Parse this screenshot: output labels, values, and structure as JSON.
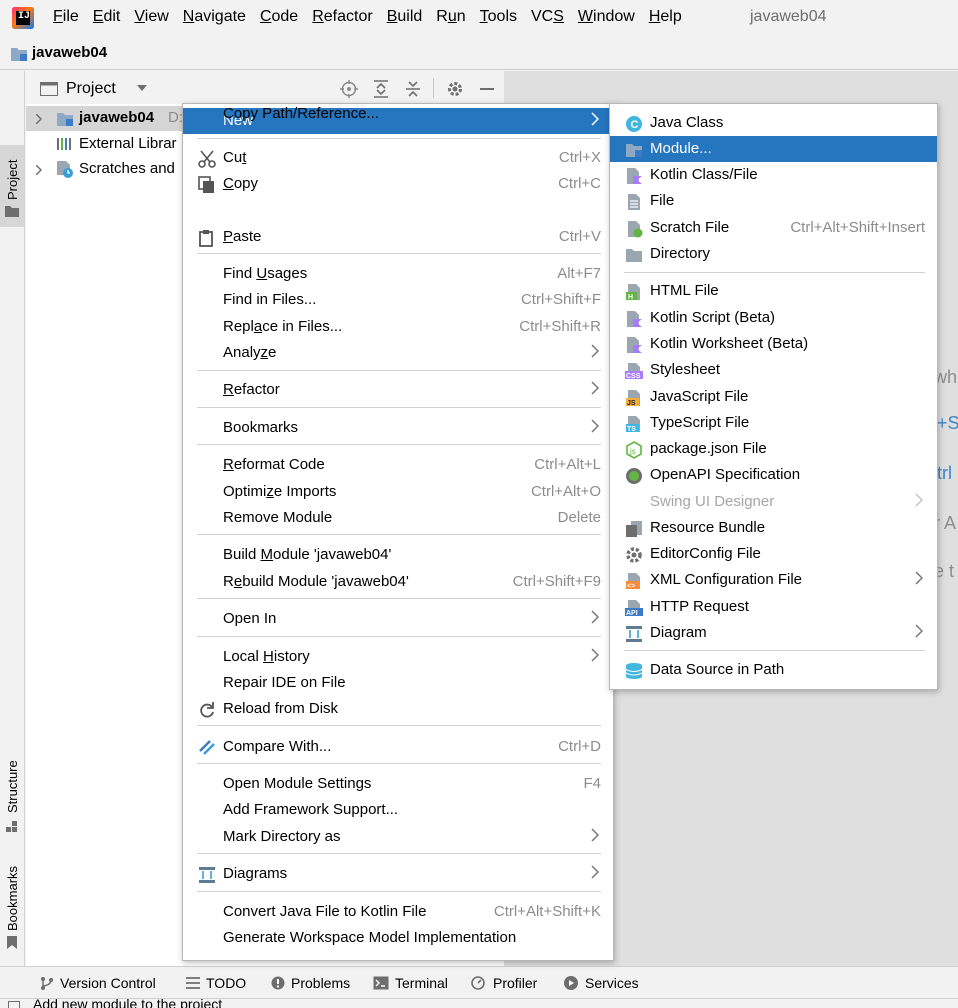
{
  "window": {
    "title": "javaweb04"
  },
  "menubar": [
    {
      "pre": "",
      "u": "F",
      "post": "ile"
    },
    {
      "pre": "",
      "u": "E",
      "post": "dit"
    },
    {
      "pre": "",
      "u": "V",
      "post": "iew"
    },
    {
      "pre": "",
      "u": "N",
      "post": "avigate"
    },
    {
      "pre": "",
      "u": "C",
      "post": "ode"
    },
    {
      "pre": "",
      "u": "R",
      "post": "efactor"
    },
    {
      "pre": "",
      "u": "B",
      "post": "uild"
    },
    {
      "pre": "R",
      "u": "u",
      "post": "n"
    },
    {
      "pre": "",
      "u": "T",
      "post": "ools"
    },
    {
      "pre": "VC",
      "u": "S",
      "post": ""
    },
    {
      "pre": "",
      "u": "W",
      "post": "indow"
    },
    {
      "pre": "",
      "u": "H",
      "post": "elp"
    }
  ],
  "breadcrumb": {
    "project": "javaweb04"
  },
  "left_strip": {
    "project": "Project",
    "structure": "Structure",
    "bookmarks": "Bookmarks"
  },
  "project_panel": {
    "title": "Project",
    "tree": [
      {
        "label": "javaweb04",
        "suffix": "D:"
      },
      {
        "label": "External Librar"
      },
      {
        "label": "Scratches and"
      }
    ]
  },
  "editor_hints": [
    "wh",
    "+S",
    "trl",
    "r A",
    "e t"
  ],
  "context_menu": [
    {
      "label_parts": [
        "New"
      ],
      "underline": [],
      "shortcut": "",
      "submenu": true,
      "highlight": true
    },
    {
      "sep": true
    },
    {
      "pre": "Cu",
      "u": "t",
      "post": "",
      "shortcut": "Ctrl+X",
      "icon": "scissors-icon"
    },
    {
      "pre": "",
      "u": "C",
      "post": "opy",
      "shortcut": "Ctrl+C",
      "icon": "copy-icon"
    },
    {
      "pre": "Copy Path/Reference...",
      "u": "",
      "post": "",
      "shortcut": ""
    },
    {
      "pre": "",
      "u": "P",
      "post": "aste",
      "shortcut": "Ctrl+V",
      "icon": "paste-icon"
    },
    {
      "sep": true
    },
    {
      "pre": "Find ",
      "u": "U",
      "post": "sages",
      "shortcut": "Alt+F7"
    },
    {
      "pre": "Find in Files...",
      "u": "",
      "post": "",
      "shortcut": "Ctrl+Shift+F"
    },
    {
      "pre": "Repl",
      "u": "a",
      "post": "ce in Files...",
      "shortcut": "Ctrl+Shift+R"
    },
    {
      "pre": "Analy",
      "u": "z",
      "post": "e",
      "shortcut": "",
      "submenu": true
    },
    {
      "sep": true
    },
    {
      "pre": "",
      "u": "R",
      "post": "efactor",
      "shortcut": "",
      "submenu": true
    },
    {
      "sep": true
    },
    {
      "pre": "Bookmarks",
      "u": "",
      "post": "",
      "shortcut": "",
      "submenu": true
    },
    {
      "sep": true
    },
    {
      "pre": "",
      "u": "R",
      "post": "eformat Code",
      "shortcut": "Ctrl+Alt+L"
    },
    {
      "pre": "Optimi",
      "u": "z",
      "post": "e Imports",
      "shortcut": "Ctrl+Alt+O"
    },
    {
      "pre": "Remove Module",
      "u": "",
      "post": "",
      "shortcut": "Delete"
    },
    {
      "sep": true
    },
    {
      "pre": "Build ",
      "u": "M",
      "post": "odule 'javaweb04'",
      "shortcut": ""
    },
    {
      "pre": "R",
      "u": "e",
      "post": "build Module 'javaweb04'",
      "shortcut": "Ctrl+Shift+F9"
    },
    {
      "sep": true
    },
    {
      "pre": "Open In",
      "u": "",
      "post": "",
      "shortcut": "",
      "submenu": true
    },
    {
      "sep": true
    },
    {
      "pre": "Local ",
      "u": "H",
      "post": "istory",
      "shortcut": "",
      "submenu": true
    },
    {
      "pre": "Repair IDE on File",
      "u": "",
      "post": "",
      "shortcut": ""
    },
    {
      "pre": "Reload from Disk",
      "u": "",
      "post": "",
      "shortcut": "",
      "icon": "reload-icon"
    },
    {
      "sep": true
    },
    {
      "pre": "Compare With...",
      "u": "",
      "post": "",
      "shortcut": "Ctrl+D",
      "icon": "compare-icon"
    },
    {
      "sep": true
    },
    {
      "pre": "Open Module Settings",
      "u": "",
      "post": "",
      "shortcut": "F4"
    },
    {
      "pre": "Add Framework Support...",
      "u": "",
      "post": "",
      "shortcut": ""
    },
    {
      "pre": "Mark Directory as",
      "u": "",
      "post": "",
      "shortcut": "",
      "submenu": true
    },
    {
      "sep": true
    },
    {
      "pre": "Diagrams",
      "u": "",
      "post": "",
      "shortcut": "",
      "submenu": true,
      "icon": "diagram-icon"
    },
    {
      "sep": true
    },
    {
      "pre": "Convert Java File to Kotlin File",
      "u": "",
      "post": "",
      "shortcut": "Ctrl+Alt+Shift+K"
    },
    {
      "pre": "Generate Workspace Model Implementation",
      "u": "",
      "post": "",
      "shortcut": ""
    }
  ],
  "new_menu": [
    {
      "label": "Java Class",
      "icon": "java-class-icon"
    },
    {
      "label": "Module...",
      "icon": "module-icon",
      "highlight": true
    },
    {
      "label": "Kotlin Class/File",
      "icon": "kotlin-file-icon"
    },
    {
      "label": "File",
      "icon": "file-icon"
    },
    {
      "label": "Scratch File",
      "icon": "scratch-file-icon",
      "shortcut": "Ctrl+Alt+Shift+Insert"
    },
    {
      "label": "Directory",
      "icon": "directory-icon"
    },
    {
      "sep": true
    },
    {
      "label": "HTML File",
      "icon": "html-file-icon"
    },
    {
      "label": "Kotlin Script (Beta)",
      "icon": "kotlin-script-icon"
    },
    {
      "label": "Kotlin Worksheet (Beta)",
      "icon": "kotlin-worksheet-icon"
    },
    {
      "label": "Stylesheet",
      "icon": "css-icon"
    },
    {
      "label": "JavaScript File",
      "icon": "js-icon"
    },
    {
      "label": "TypeScript File",
      "icon": "ts-icon"
    },
    {
      "label": "package.json File",
      "icon": "nodejs-icon"
    },
    {
      "label": "OpenAPI Specification",
      "icon": "openapi-icon"
    },
    {
      "label": "Swing UI Designer",
      "disabled": true,
      "submenu": true
    },
    {
      "label": "Resource Bundle",
      "icon": "resource-bundle-icon"
    },
    {
      "label": "EditorConfig File",
      "icon": "gear-icon"
    },
    {
      "label": "XML Configuration File",
      "icon": "xml-icon",
      "submenu": true
    },
    {
      "label": "HTTP Request",
      "icon": "api-icon"
    },
    {
      "label": "Diagram",
      "icon": "diagram-icon",
      "submenu": true
    },
    {
      "sep": true
    },
    {
      "label": "Data Source in Path",
      "icon": "database-icon"
    }
  ],
  "bottom_tools": [
    {
      "label": "Version Control",
      "icon": "vcs-icon"
    },
    {
      "label": "TODO",
      "icon": "todo-icon"
    },
    {
      "label": "Problems",
      "icon": "problems-icon"
    },
    {
      "label": "Terminal",
      "icon": "terminal-icon"
    },
    {
      "label": "Profiler",
      "icon": "profiler-icon"
    },
    {
      "label": "Services",
      "icon": "services-icon"
    }
  ],
  "status": {
    "text": "Add new module to the project"
  },
  "colors": {
    "highlight": "#2675bf",
    "folder": "#8ea9c4"
  }
}
